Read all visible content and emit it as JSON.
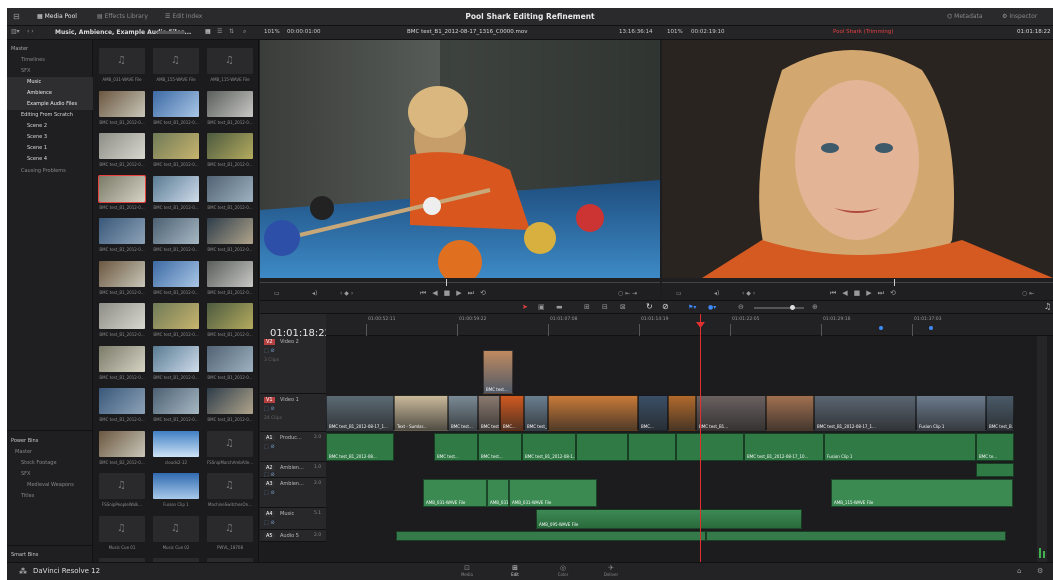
{
  "top": {
    "title": "Pool Shark Editing Refinement",
    "media_pool": "Media Pool",
    "effects": "Effects Library",
    "edit_index": "Edit Index",
    "metadata": "Metadata",
    "inspector": "Inspector"
  },
  "sub": {
    "bin_path": "Music, Ambience, Example Audio Files...",
    "zoom_left": "101%",
    "tc_left": "00:00:01:00",
    "clip_name": "BMC test_B1_2012-08-17_1316_C0000.mov",
    "tc_source": "13:16:36:14",
    "zoom_right": "101%",
    "tc_right": "00:02:19:10",
    "timeline_name": "Pool Shark (Trimming)",
    "tc_timeline": "01:01:18:22"
  },
  "bins": {
    "master": "Master",
    "timelines": "Timelines",
    "sfx": "SFX",
    "music": "Music",
    "ambience": "Ambience",
    "example_audio": "Example Audio Files",
    "editing": "Editing From Scratch",
    "scene2": "Scene 2",
    "scene3": "Scene 3",
    "scene1": "Scene 1",
    "scene4": "Scene 4",
    "causing": "Causing Problems",
    "power_bins": "Power Bins",
    "pb_master": "Master",
    "stock": "Stock Footage",
    "pb_sfx": "SFX",
    "medieval": "Medieval Weapons",
    "titles": "Titles",
    "smart_bins": "Smart Bins"
  },
  "pool": {
    "row0": [
      "AMB_031-WAVE File",
      "AMB_155-WAVE File",
      "AMB_115-WAVE File"
    ],
    "rowB": [
      "BMC test_B1_2012-0...",
      "BMC test_B1_2012-0...",
      "BMC test_B1_2012-0..."
    ],
    "row10": [
      "BMC test_B2_2012-0...",
      "clouds2-12",
      "FSSnipMarchAmbAlle..."
    ],
    "row11": [
      "FSSnipPeopleWalk...",
      "Fusion Clip 1",
      "MachineSwitchesOn..."
    ],
    "row12": [
      "Music Cue 01",
      "Music Cue 02",
      "PWVL_18708"
    ],
    "row13": [
      "PWVL_16702",
      "PWVL_18703",
      "PWVL_18704"
    ]
  },
  "timeline": {
    "timecode": "01:01:18:22",
    "ruler": [
      "01:00:52:11",
      "01:00:59:22",
      "01:01:07:08",
      "01:01:14:19",
      "01:01:22:05",
      "01:01:29:16",
      "01:01:37:03"
    ],
    "tracks": [
      {
        "id": "V2",
        "name": "Video 2"
      },
      {
        "id": "V1",
        "name": "Video 1"
      },
      {
        "id": "A1",
        "name": "Produc...",
        "ch": "2.0"
      },
      {
        "id": "A2",
        "name": "Ambien...",
        "ch": "1.0"
      },
      {
        "id": "A3",
        "name": "Ambien...",
        "ch": "2.0"
      },
      {
        "id": "A4",
        "name": "Music",
        "ch": "5.1"
      },
      {
        "id": "A5",
        "name": "Audio 5",
        "ch": "2.0"
      }
    ],
    "v2_clip": "BMC test...",
    "v1_labels": [
      "BMC test_B1_2012-08-17_1...",
      "Text - Sumlar...",
      "BMC test...",
      "BMC test...",
      "BMC...",
      "BMC test_B1_2012-08-17_1...",
      "BMC...",
      "BMC test_B1...",
      "BMC test_B1_2012-08-17_1...",
      "Fusion Clip 1",
      "BMC test_B..."
    ],
    "a1_labels": [
      "BMC test_B1_2012-08...",
      "BMC test...",
      "BMC test...",
      "BMC test_B1_2012-08-1...",
      "BMC test_B1...",
      "BMC test_B1_2012-08-17_10...",
      "Fusion Clip 1",
      "BMC te..."
    ],
    "a3_labels": [
      "AMB_031-WAVE File",
      "AMB_031...",
      "AMB_031-WAVE File",
      "AMB_115-WAVE File"
    ],
    "a4_label": "AMB_095-WAVE File",
    "v2_sub": "3 Clips",
    "v1_sub": "24 Clips"
  },
  "bottom": {
    "app": "DaVinci Resolve 12",
    "pages": [
      "Media",
      "Edit",
      "Color",
      "Deliver"
    ]
  },
  "colors": {
    "accent": "#e64040",
    "audio": "#2f7a45",
    "playhead": "#e03030"
  }
}
